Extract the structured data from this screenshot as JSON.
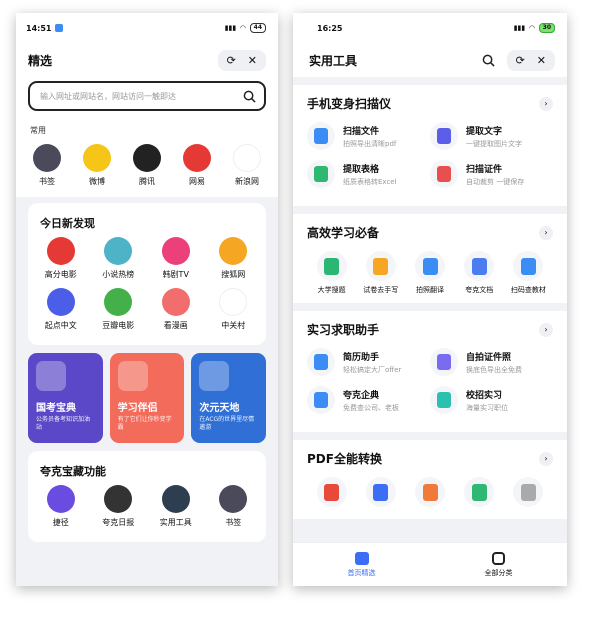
{
  "left": {
    "status": {
      "time": "14:51",
      "battery": "44"
    },
    "title": "精选",
    "search_placeholder": "输入网址或网站名，网站访问一触即达",
    "common_label": "常用",
    "common": [
      {
        "label": "书签",
        "color": "#4a4a5a"
      },
      {
        "label": "微博",
        "color": "#f5c518"
      },
      {
        "label": "腾讯",
        "color": "#222222"
      },
      {
        "label": "网易",
        "color": "#e53935"
      },
      {
        "label": "新浪网",
        "color": "#ffffff"
      }
    ],
    "discover_title": "今日新发现",
    "discover": [
      {
        "label": "高分电影",
        "color": "#e53935"
      },
      {
        "label": "小说热榜",
        "color": "#4fb3c7"
      },
      {
        "label": "韩剧TV",
        "color": "#ec407a"
      },
      {
        "label": "搜狐网",
        "color": "#f5a623"
      },
      {
        "label": "起点中文",
        "color": "#4a5ee8"
      },
      {
        "label": "豆瓣电影",
        "color": "#43b049"
      },
      {
        "label": "看漫画",
        "color": "#f26d6d"
      },
      {
        "label": "中关村",
        "color": "#ffffff"
      }
    ],
    "promos": [
      {
        "title": "国考宝典",
        "sub": "公务员备考知识加油站",
        "color": "#5b48c8"
      },
      {
        "title": "学习伴侣",
        "sub": "有了它们让你秒变学霸",
        "color": "#f26b5b"
      },
      {
        "title": "次元天地",
        "sub": "在ACG的世界里尽情遨游",
        "color": "#2f6fd6"
      }
    ],
    "treasure_title": "夸克宝藏功能",
    "treasure": [
      {
        "label": "捷径",
        "color": "#6a4de0"
      },
      {
        "label": "夸克日报",
        "color": "#333333"
      },
      {
        "label": "实用工具",
        "color": "#2c3e50"
      },
      {
        "label": "书签",
        "color": "#4a4a5a"
      }
    ]
  },
  "right": {
    "status": {
      "time": "16:25",
      "battery": "30"
    },
    "title": "实用工具",
    "sections": [
      {
        "title": "手机变身扫描仪",
        "tools": [
          {
            "name": "扫描文件",
            "desc": "拍照导出清晰pdf",
            "color": "#3b8cf5"
          },
          {
            "name": "提取文字",
            "desc": "一键提取图片文字",
            "color": "#5b5ee8"
          },
          {
            "name": "提取表格",
            "desc": "纸质表格转Excel",
            "color": "#2eb872"
          },
          {
            "name": "扫描证件",
            "desc": "自动裁剪 一键保存",
            "color": "#e85050"
          }
        ]
      },
      {
        "title": "高效学习必备",
        "items": [
          {
            "label": "大学搜题",
            "color": "#2bb673"
          },
          {
            "label": "试卷去手写",
            "color": "#f5a623"
          },
          {
            "label": "拍照翻译",
            "color": "#3b8cf5"
          },
          {
            "label": "夸克文档",
            "color": "#4a7df0"
          },
          {
            "label": "扫码查教材",
            "color": "#3b8cf5"
          }
        ]
      },
      {
        "title": "实习求职助手",
        "tools": [
          {
            "name": "简历助手",
            "desc": "轻松搞定大厂offer",
            "color": "#3b8cf5"
          },
          {
            "name": "自拍证件照",
            "desc": "换底色导出全免费",
            "color": "#7a6cf0"
          },
          {
            "name": "夸克企典",
            "desc": "免费查公司、老板",
            "color": "#3b8cf5"
          },
          {
            "name": "校招实习",
            "desc": "海量实习职位",
            "color": "#2cc0b0"
          }
        ]
      },
      {
        "title": "PDF全能转换",
        "items": [
          {
            "label": "",
            "color": "#e84a3a"
          },
          {
            "label": "",
            "color": "#3b6df5"
          },
          {
            "label": "",
            "color": "#f07a3a"
          },
          {
            "label": "",
            "color": "#2eb872"
          },
          {
            "label": "",
            "color": "#aaaaaa"
          }
        ]
      }
    ],
    "nav": [
      {
        "label": "首页精选"
      },
      {
        "label": "全部分类"
      }
    ]
  }
}
